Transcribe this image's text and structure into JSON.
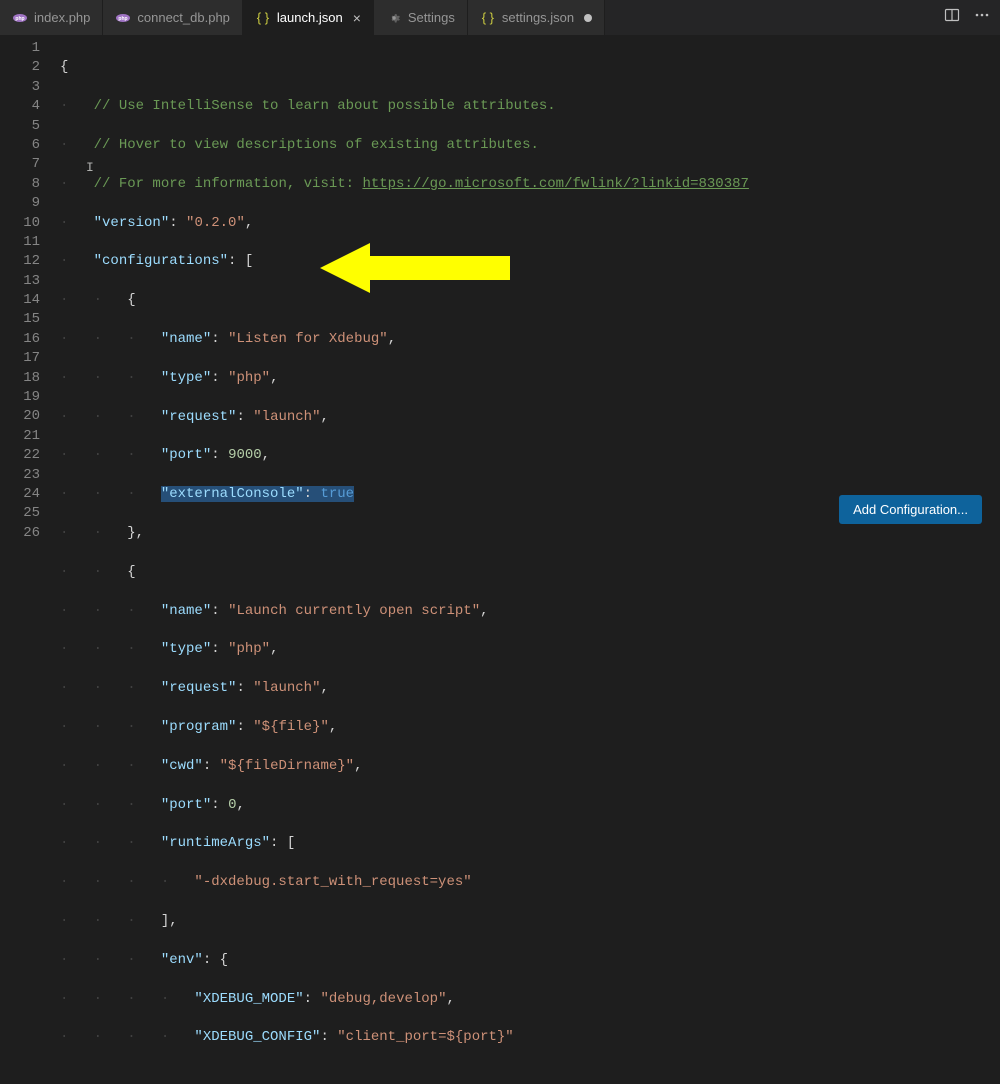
{
  "tabs": [
    {
      "label": "index.php",
      "icon": "php",
      "active": false,
      "dirty": false,
      "close": false
    },
    {
      "label": "connect_db.php",
      "icon": "php",
      "active": false,
      "dirty": false,
      "close": false
    },
    {
      "label": "launch.json",
      "icon": "json",
      "active": true,
      "dirty": false,
      "close": true
    },
    {
      "label": "Settings",
      "icon": "gear",
      "active": false,
      "dirty": false,
      "close": false
    },
    {
      "label": "settings.json",
      "icon": "json",
      "active": false,
      "dirty": true,
      "close": false
    }
  ],
  "addConfigLabel": "Add Configuration...",
  "lines": {
    "c2": "// Use IntelliSense to learn about possible attributes.",
    "c3": "// Hover to view descriptions of existing attributes.",
    "c4a": "// For more information, visit: ",
    "c4b": "https://go.microsoft.com/fwlink/?linkid=830387",
    "k_version": "\"version\"",
    "v_version": "\"0.2.0\"",
    "k_configs": "\"configurations\"",
    "k_name": "\"name\"",
    "v_name1": "\"Listen for Xdebug\"",
    "k_type": "\"type\"",
    "v_type": "\"php\"",
    "k_request": "\"request\"",
    "v_request": "\"launch\"",
    "k_port": "\"port\"",
    "v_port1": "9000",
    "k_extcons": "\"externalConsole\"",
    "v_true": "true",
    "v_name2": "\"Launch currently open script\"",
    "k_program": "\"program\"",
    "v_program": "\"${file}\"",
    "k_cwd": "\"cwd\"",
    "v_cwd": "\"${fileDirname}\"",
    "v_port2": "0",
    "k_rargs": "\"runtimeArgs\"",
    "v_rargs1": "\"-dxdebug.start_with_request=yes\"",
    "k_env": "\"env\"",
    "k_xmode": "\"XDEBUG_MODE\"",
    "v_xmode": "\"debug,develop\"",
    "k_xconf": "\"XDEBUG_CONFIG\"",
    "v_xconf": "\"client_port=${port}\""
  },
  "lineNumbers": [
    "1",
    "2",
    "3",
    "4",
    "5",
    "6",
    "7",
    "8",
    "9",
    "10",
    "11",
    "12",
    "13",
    "14",
    "15",
    "16",
    "17",
    "18",
    "19",
    "20",
    "21",
    "22",
    "23",
    "24",
    "25",
    "26"
  ]
}
